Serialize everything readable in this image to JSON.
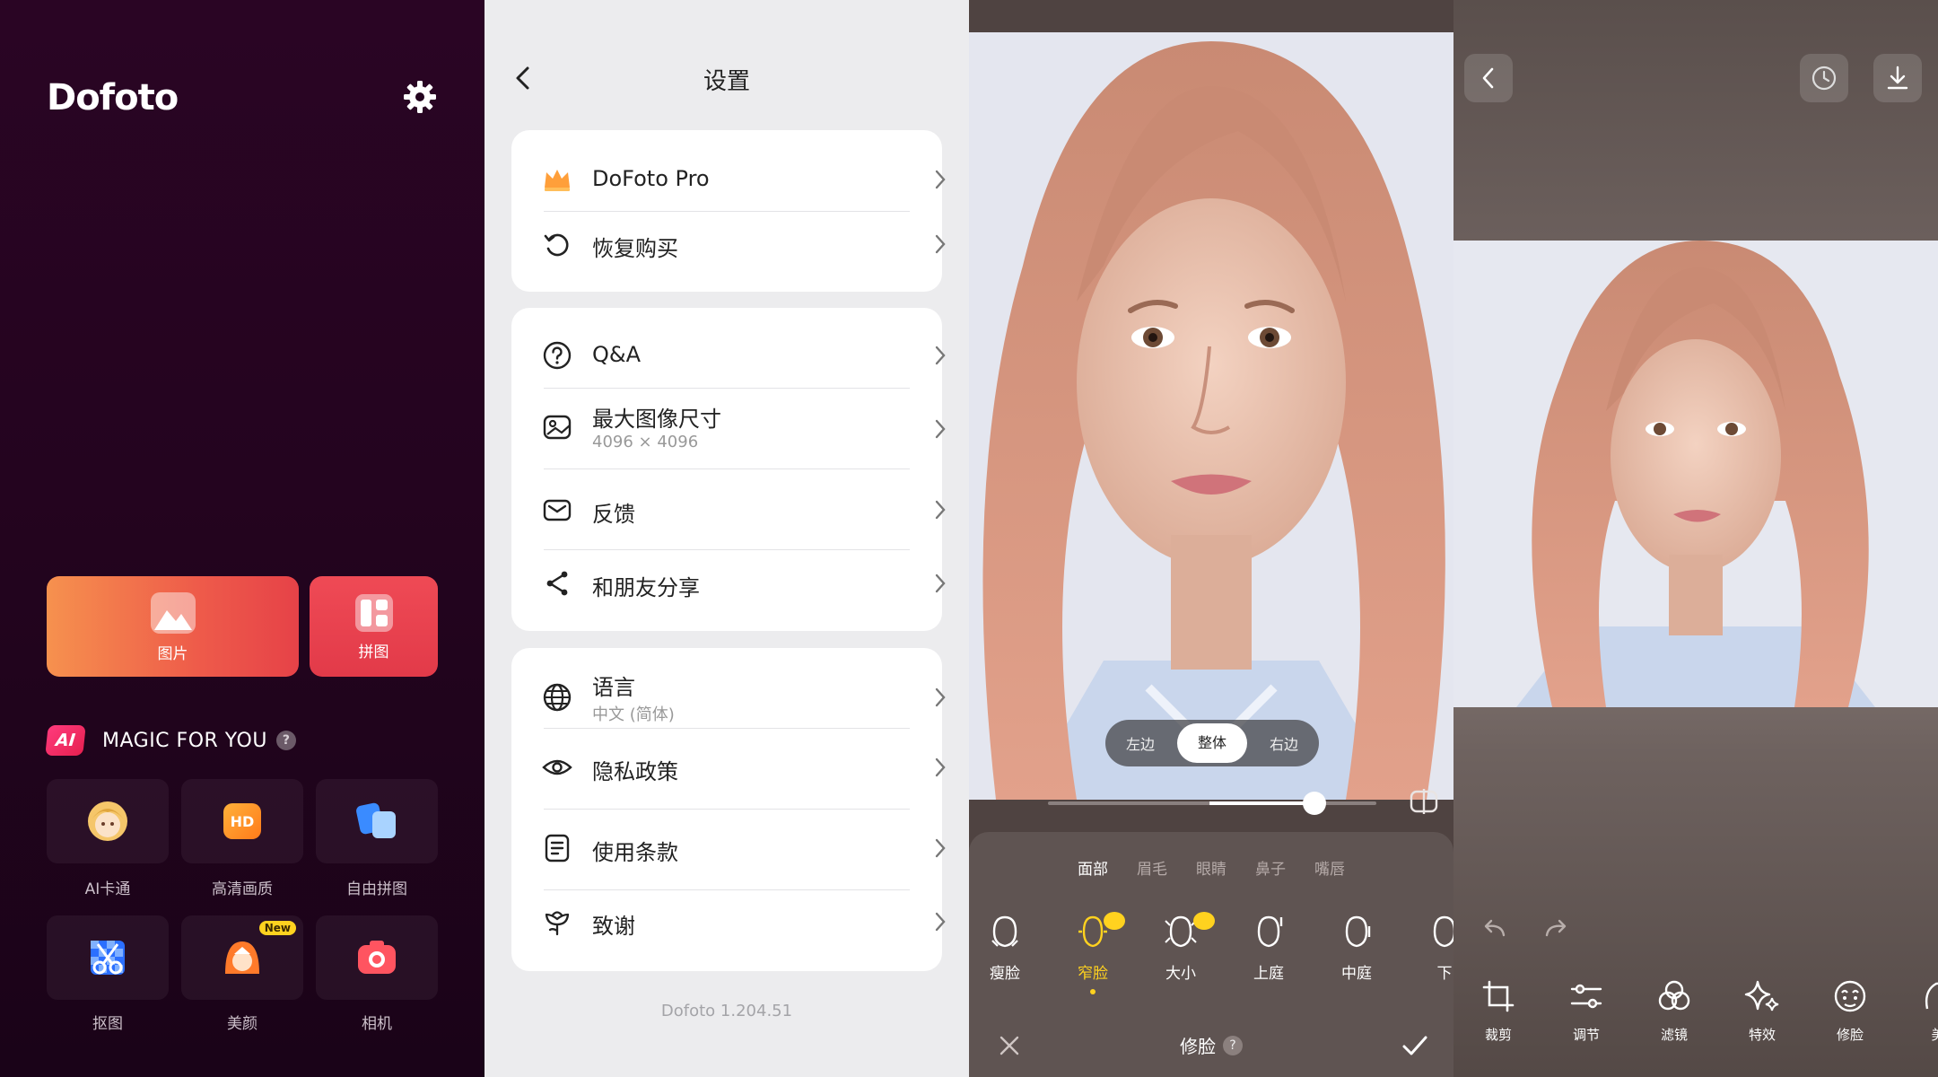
{
  "home": {
    "logo": "Dofoto",
    "photo_label": "图片",
    "collage_label": "拼图",
    "ai_badge": "AI",
    "magic_title": "MAGIC FOR YOU",
    "help": "?",
    "tiles": [
      {
        "label": "AI卡通"
      },
      {
        "label": "高清画质",
        "badge": "HD"
      },
      {
        "label": "自由拼图"
      },
      {
        "label": "抠图"
      },
      {
        "label": "美颜",
        "new_badge": "New"
      },
      {
        "label": "相机"
      }
    ]
  },
  "settings": {
    "title": "设置",
    "items": [
      {
        "label": "DoFoto Pro"
      },
      {
        "label": "恢复购买"
      },
      {
        "label": "Q&A"
      },
      {
        "label": "最大图像尺寸",
        "sub": "4096 × 4096"
      },
      {
        "label": "反馈"
      },
      {
        "label": "和朋友分享"
      },
      {
        "label": "语言",
        "sub": "中文 (简体)"
      },
      {
        "label": "隐私政策"
      },
      {
        "label": "使用条款"
      },
      {
        "label": "致谢"
      }
    ],
    "version": "Dofoto 1.204.51"
  },
  "face_editor": {
    "segments": [
      "左边",
      "整体",
      "右边"
    ],
    "active_segment": "整体",
    "slider_level": 0.6,
    "categories": [
      "面部",
      "眉毛",
      "眼睛",
      "鼻子",
      "嘴唇"
    ],
    "active_category": "面部",
    "tools": [
      "瘦脸",
      "窄脸",
      "大小",
      "上庭",
      "中庭",
      "下"
    ],
    "active_tool": "窄脸",
    "title": "修脸",
    "help": "?"
  },
  "editor": {
    "tools": [
      "裁剪",
      "调节",
      "滤镜",
      "特效",
      "修脸",
      "美"
    ]
  },
  "colors": {
    "accent": "#ffd21f",
    "home_bg": "#24041f",
    "photo_btn": "#ee5b4a",
    "collage_btn": "#e23a49",
    "ai_badge": "#ff3b7d"
  }
}
